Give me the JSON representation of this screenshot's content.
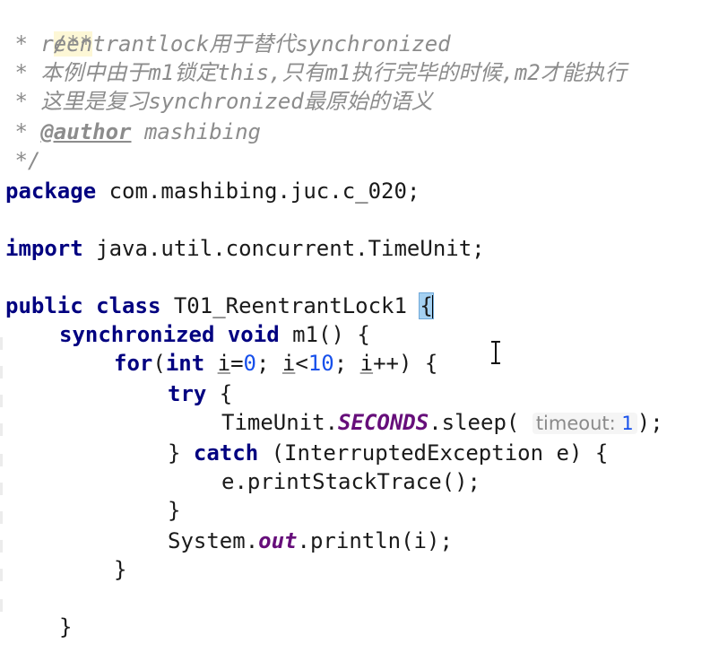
{
  "editor": {
    "comment": {
      "open": "/**",
      "star": " * ",
      "line1": "reentrantlock用于替代synchronized",
      "line2": "本例中由于m1锁定this,只有m1执行完毕的时候,m2才能执行",
      "line3": "这里是复习synchronized最原始的语义",
      "author_tag": "@author",
      "author_name": " mashibing",
      "close": " */"
    },
    "package_kw": "package",
    "package_name": " com.mashibing.juc.c_020;",
    "import_kw": "import",
    "import_name": " java.util.concurrent.TimeUnit;",
    "class_decl": {
      "public_kw": "public",
      "class_kw": "class",
      "name": "T01_ReentrantLock1",
      "open_brace": "{"
    },
    "method_decl": {
      "sync_kw": "synchronized",
      "void_kw": "void",
      "name": "m1",
      "rest": "() {"
    },
    "for_line": {
      "for_kw": "for",
      "paren_open": "(",
      "int_kw": "int",
      "var": "i",
      "eq": "=",
      "zero": "0",
      "semi1": "; ",
      "var2": "i",
      "lt": "<",
      "ten": "10",
      "semi2": "; ",
      "var3": "i",
      "inc": "++) {"
    },
    "try_line": {
      "try_kw": "try",
      "rest": " {"
    },
    "sleep_line": {
      "class_name": "TimeUnit.",
      "field": "SECONDS",
      "method": ".sleep(",
      "hint_label": "timeout:",
      "hint_value": "1",
      "close": ");"
    },
    "catch_line": {
      "open": "} ",
      "catch_kw": "catch",
      "rest": " (InterruptedException e) {"
    },
    "print_stack_line": "e.printStackTrace();",
    "close_brace_try": "}",
    "println_line": {
      "prefix": "System.",
      "field": "out",
      "rest": ".println(i);"
    },
    "close_brace_for": "}",
    "close_brace_method": "}"
  }
}
